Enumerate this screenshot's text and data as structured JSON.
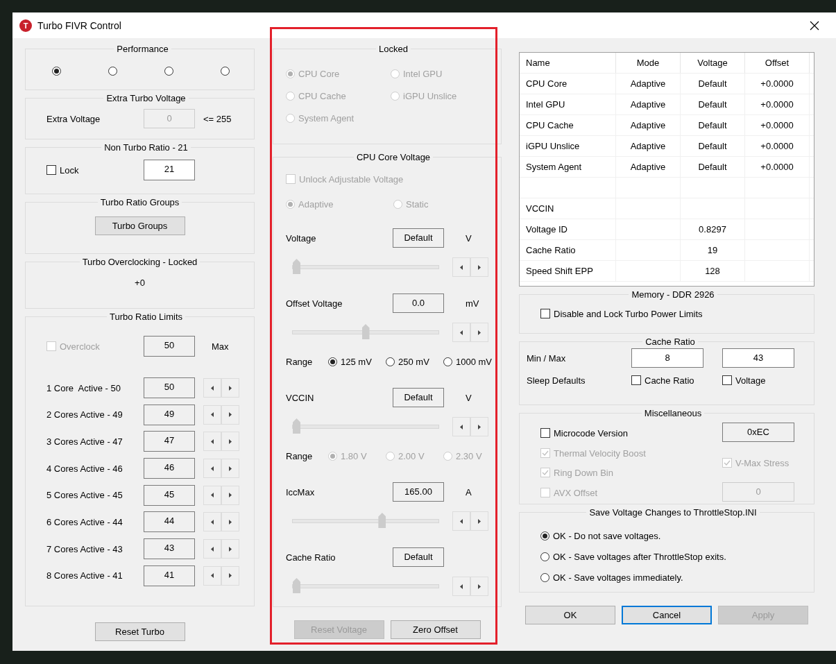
{
  "window": {
    "title": "Turbo FIVR Control",
    "icon_letter": "T"
  },
  "performance": {
    "title": "Performance",
    "options": [
      {
        "selected": true
      },
      {
        "selected": false
      },
      {
        "selected": false
      },
      {
        "selected": false
      }
    ]
  },
  "extra_turbo_voltage": {
    "title": "Extra Turbo Voltage",
    "label": "Extra Voltage",
    "value": "0",
    "disabled": true,
    "limit": "<= 255"
  },
  "non_turbo_ratio": {
    "title": "Non Turbo Ratio - 21",
    "lock": {
      "label": "Lock",
      "checked": false
    },
    "value": "21"
  },
  "turbo_ratio_groups": {
    "title": "Turbo Ratio Groups",
    "button": "Turbo Groups"
  },
  "turbo_overclocking": {
    "title": "Turbo Overclocking - Locked",
    "value": "+0"
  },
  "turbo_ratio_limits": {
    "title": "Turbo Ratio Limits",
    "overclock": {
      "label": "Overclock",
      "checked": false,
      "disabled": true
    },
    "max_value": "50",
    "max_label": "Max",
    "rows": [
      {
        "label": "1 Core  Active - 50",
        "value": "50"
      },
      {
        "label": "2 Cores Active - 49",
        "value": "49"
      },
      {
        "label": "3 Cores Active - 47",
        "value": "47"
      },
      {
        "label": "4 Cores Active - 46",
        "value": "46"
      },
      {
        "label": "5 Cores Active - 45",
        "value": "45"
      },
      {
        "label": "6 Cores Active - 44",
        "value": "44"
      },
      {
        "label": "7 Cores Active - 43",
        "value": "43"
      },
      {
        "label": "8 Cores Active - 41",
        "value": "41"
      }
    ]
  },
  "reset_turbo_button": "Reset Turbo",
  "locked": {
    "title": "Locked",
    "disabled": true,
    "options": [
      {
        "label": "CPU Core",
        "selected": true
      },
      {
        "label": "Intel GPU",
        "selected": false
      },
      {
        "label": "CPU Cache",
        "selected": false
      },
      {
        "label": "iGPU Unslice",
        "selected": false
      },
      {
        "label": "System Agent",
        "selected": false
      }
    ]
  },
  "cpu_core_voltage": {
    "title": "CPU Core Voltage",
    "unlock": {
      "label": "Unlock Adjustable Voltage",
      "checked": false,
      "disabled": true
    },
    "modes": [
      {
        "label": "Adaptive",
        "selected": true
      },
      {
        "label": "Static",
        "selected": false
      }
    ],
    "controls": [
      {
        "kind": "slider",
        "label": "Voltage",
        "value": "Default",
        "unit": "V",
        "level": 0
      },
      {
        "kind": "slider",
        "label": "Offset Voltage",
        "value": "0.0",
        "unit": "mV",
        "level": 0.5
      },
      {
        "kind": "range",
        "label": "Range",
        "disabled": false,
        "options": [
          {
            "label": "125 mV",
            "selected": true
          },
          {
            "label": "250 mV",
            "selected": false
          },
          {
            "label": "1000 mV",
            "selected": false
          }
        ]
      },
      {
        "kind": "slider",
        "label": "VCCIN",
        "value": "Default",
        "unit": "V",
        "level": 0
      },
      {
        "kind": "range",
        "label": "Range",
        "disabled": true,
        "options": [
          {
            "label": "1.80 V",
            "selected": true
          },
          {
            "label": "2.00 V",
            "selected": false
          },
          {
            "label": "2.30 V",
            "selected": false
          }
        ]
      },
      {
        "kind": "slider",
        "label": "IccMax",
        "value": "165.00",
        "unit": "A",
        "level": 0.62
      },
      {
        "kind": "slider",
        "label": "Cache Ratio",
        "value": "Default",
        "level": 0
      }
    ]
  },
  "voltage_buttons": [
    {
      "label": "Reset Voltage",
      "disabled": true
    },
    {
      "label": "Zero Offset",
      "disabled": false
    }
  ],
  "voltage_table": {
    "columns": [
      "Name",
      "Mode",
      "Voltage",
      "Offset"
    ],
    "rows": [
      {
        "name": "CPU Core",
        "mode": "Adaptive",
        "voltage": "Default",
        "offset": "+0.0000"
      },
      {
        "name": "Intel GPU",
        "mode": "Adaptive",
        "voltage": "Default",
        "offset": "+0.0000"
      },
      {
        "name": "CPU Cache",
        "mode": "Adaptive",
        "voltage": "Default",
        "offset": "+0.0000"
      },
      {
        "name": "iGPU Unslice",
        "mode": "Adaptive",
        "voltage": "Default",
        "offset": "+0.0000"
      },
      {
        "name": "System Agent",
        "mode": "Adaptive",
        "voltage": "Default",
        "offset": "+0.0000"
      },
      {},
      {
        "name": "VCCIN"
      },
      {
        "name": "Voltage ID",
        "voltage": "0.8297"
      },
      {
        "name": "Cache Ratio",
        "voltage": "19"
      },
      {
        "name": "Speed Shift EPP",
        "voltage": "128"
      }
    ]
  },
  "memory": {
    "title": "Memory - DDR 2926",
    "option": {
      "label": "Disable and Lock Turbo Power Limits",
      "checked": false
    }
  },
  "cache_ratio": {
    "title": "Cache Ratio",
    "min_max_label": "Min / Max",
    "min": "8",
    "max": "43",
    "sleep_label": "Sleep Defaults",
    "sleep_options": [
      {
        "label": "Cache Ratio",
        "checked": false
      },
      {
        "label": "Voltage",
        "checked": false
      }
    ]
  },
  "miscellaneous": {
    "title": "Miscellaneous",
    "items": [
      {
        "label": "Microcode Version",
        "checked": false,
        "disabled": false
      },
      {
        "label": "Thermal Velocity Boost",
        "checked": true,
        "disabled": true
      },
      {
        "label": "Ring Down Bin",
        "checked": true,
        "disabled": true
      },
      {
        "label": "AVX Offset",
        "checked": false,
        "disabled": true
      }
    ],
    "microcode_value": "0xEC",
    "vmax": {
      "label": "V-Max Stress",
      "checked": true,
      "disabled": true
    },
    "avx_value": "0",
    "avx_disabled": true
  },
  "save_voltage": {
    "title": "Save Voltage Changes to ThrottleStop.INI",
    "options": [
      {
        "label": "OK - Do not save voltages.",
        "selected": true
      },
      {
        "label": "OK - Save voltages after ThrottleStop exits.",
        "selected": false
      },
      {
        "label": "OK - Save voltages immediately.",
        "selected": false
      }
    ]
  },
  "dialog_buttons": [
    {
      "label": "OK",
      "disabled": false,
      "focused": false
    },
    {
      "label": "Cancel",
      "disabled": false,
      "focused": true
    },
    {
      "label": "Apply",
      "disabled": true,
      "focused": false
    }
  ]
}
